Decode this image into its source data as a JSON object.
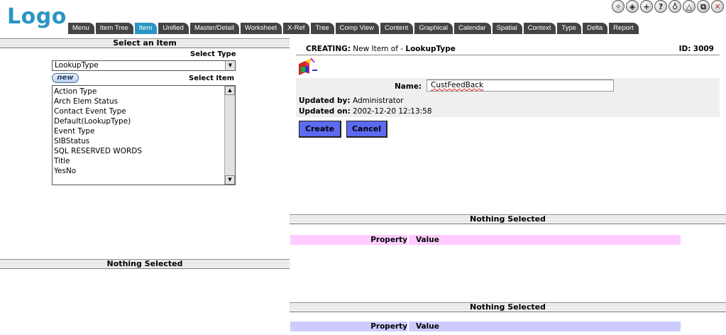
{
  "logo": "Logo",
  "top_icons": [
    {
      "name": "gear-outline-icon",
      "glyph": "✧"
    },
    {
      "name": "palette-icon",
      "glyph": "◈"
    },
    {
      "name": "plus-icon",
      "glyph": "+"
    },
    {
      "name": "help-icon",
      "glyph": "?"
    },
    {
      "name": "pin-icon",
      "glyph": "♁"
    },
    {
      "name": "triangle-icon",
      "glyph": "△"
    },
    {
      "name": "windows-icon",
      "glyph": "⧉"
    },
    {
      "name": "close-icon",
      "glyph": "✕"
    }
  ],
  "tabs": [
    {
      "label": "Menu"
    },
    {
      "label": "Item Tree"
    },
    {
      "label": "Item",
      "active": true
    },
    {
      "label": "Unified"
    },
    {
      "label": "Master/Detail"
    },
    {
      "label": "Worksheet"
    },
    {
      "label": "X-Ref"
    },
    {
      "label": "Tree"
    },
    {
      "label": "Comp View"
    },
    {
      "label": "Content"
    },
    {
      "label": "Graphical"
    },
    {
      "label": "Calendar"
    },
    {
      "label": "Spatial"
    },
    {
      "label": "Context"
    },
    {
      "label": "Type"
    },
    {
      "label": "Delta"
    },
    {
      "label": "Report"
    }
  ],
  "left": {
    "header": "Select an Item",
    "select_type_label": "Select Type",
    "select_type_value": "LookupType",
    "new_button": "new",
    "select_item_label": "Select Item",
    "items": [
      "Action Type",
      "Arch Elem Status",
      "Contact Event Type",
      "Default(LookupType)",
      "Event Type",
      "SIBStatus",
      "SQL RESERVED WORDS",
      "Title",
      "YesNo"
    ],
    "bottom_header": "Nothing Selected"
  },
  "form": {
    "creating_label": "CREATING:",
    "creating_text": "New Item of -",
    "type_name": "LookupType",
    "id_label": "ID:",
    "id_value": "3009",
    "name_label": "Name:",
    "name_value": "CustFeedBack",
    "updated_by_label": "Updated by:",
    "updated_by_value": "Administrator",
    "updated_on_label": "Updated on:",
    "updated_on_value": "2002-12-20 12:13:58",
    "create_button": "Create",
    "cancel_button": "Cancel"
  },
  "panels": [
    {
      "header": "Nothing Selected",
      "property_label": "Property",
      "value_label": "Value",
      "color": "#ffccff"
    },
    {
      "header": "Nothing Selected",
      "property_label": "Property",
      "value_label": "Value",
      "color": "#ccccff"
    }
  ]
}
